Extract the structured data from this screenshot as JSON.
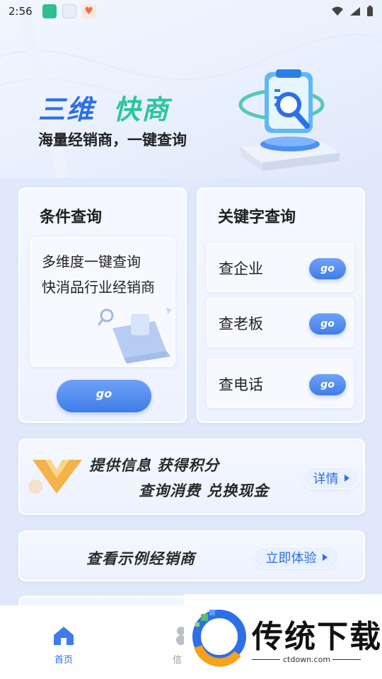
{
  "status_bar": {
    "time": "2:56"
  },
  "hero": {
    "title_part1": "三维",
    "title_part2": "快商",
    "subtitle": "海量经销商，一键查询"
  },
  "condition_card": {
    "title": "条件查询",
    "line1": "多维度一键查询",
    "line2": "快消品行业经销商",
    "go_label": "go"
  },
  "keyword_card": {
    "title": "关键字查询",
    "items": [
      {
        "label": "查企业",
        "go_label": "go"
      },
      {
        "label": "查老板",
        "go_label": "go"
      },
      {
        "label": "查电话",
        "go_label": "go"
      }
    ]
  },
  "promo": {
    "line1": "提供信息  获得积分",
    "line2": "查询消费  兑换现金",
    "button_label": "详情"
  },
  "example": {
    "text": "查看示例经销商",
    "button_label": "立即体验"
  },
  "bottom_nav": {
    "home_label": "首页",
    "partial_label": "信"
  },
  "watermark": {
    "brand": "传统下载",
    "url": "ctdown.com"
  },
  "colors": {
    "accent_blue": "#2d6fe8",
    "accent_green": "#2ec4a0",
    "background": "#dfe9fb"
  }
}
